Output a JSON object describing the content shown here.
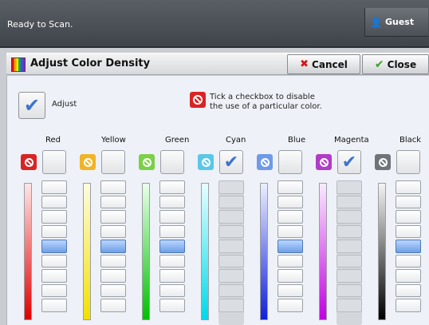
{
  "status_bar": {
    "message": "Ready to Scan.",
    "user_label": "Guest",
    "user_icon": "person-icon"
  },
  "dialog": {
    "title": "Adjust Color Density",
    "cancel_label": "Cancel",
    "close_label": "Close"
  },
  "adjust": {
    "label": "Adjust",
    "checked": true
  },
  "hint": {
    "line1": "Tick a checkbox to disable",
    "line2": "the use of a particular color."
  },
  "colors": [
    {
      "name": "Red",
      "accent": "#d92424",
      "gradient_top": "#ffe6e6",
      "gradient_bottom": "#e00000",
      "disabled": false,
      "level_step": 5
    },
    {
      "name": "Yellow",
      "accent": "#f0b429",
      "gradient_top": "#fffbe0",
      "gradient_bottom": "#f2e000",
      "disabled": false,
      "level_step": 5
    },
    {
      "name": "Green",
      "accent": "#7bd048",
      "gradient_top": "#eaffea",
      "gradient_bottom": "#00c000",
      "disabled": false,
      "level_step": 5
    },
    {
      "name": "Cyan",
      "accent": "#5bc7e8",
      "gradient_top": "#e6ffff",
      "gradient_bottom": "#00d8e8",
      "disabled": true,
      "level_step": null
    },
    {
      "name": "Blue",
      "accent": "#6f9ae8",
      "gradient_top": "#ecefff",
      "gradient_bottom": "#1020d8",
      "disabled": false,
      "level_step": 5
    },
    {
      "name": "Magenta",
      "accent": "#b03cc8",
      "gradient_top": "#fbeaff",
      "gradient_bottom": "#c000e0",
      "disabled": true,
      "level_step": null
    },
    {
      "name": "Black",
      "accent": "#707478",
      "gradient_top": "#f4f4f4",
      "gradient_bottom": "#000000",
      "disabled": false,
      "level_step": 5
    }
  ],
  "steps_per_scale": 9
}
